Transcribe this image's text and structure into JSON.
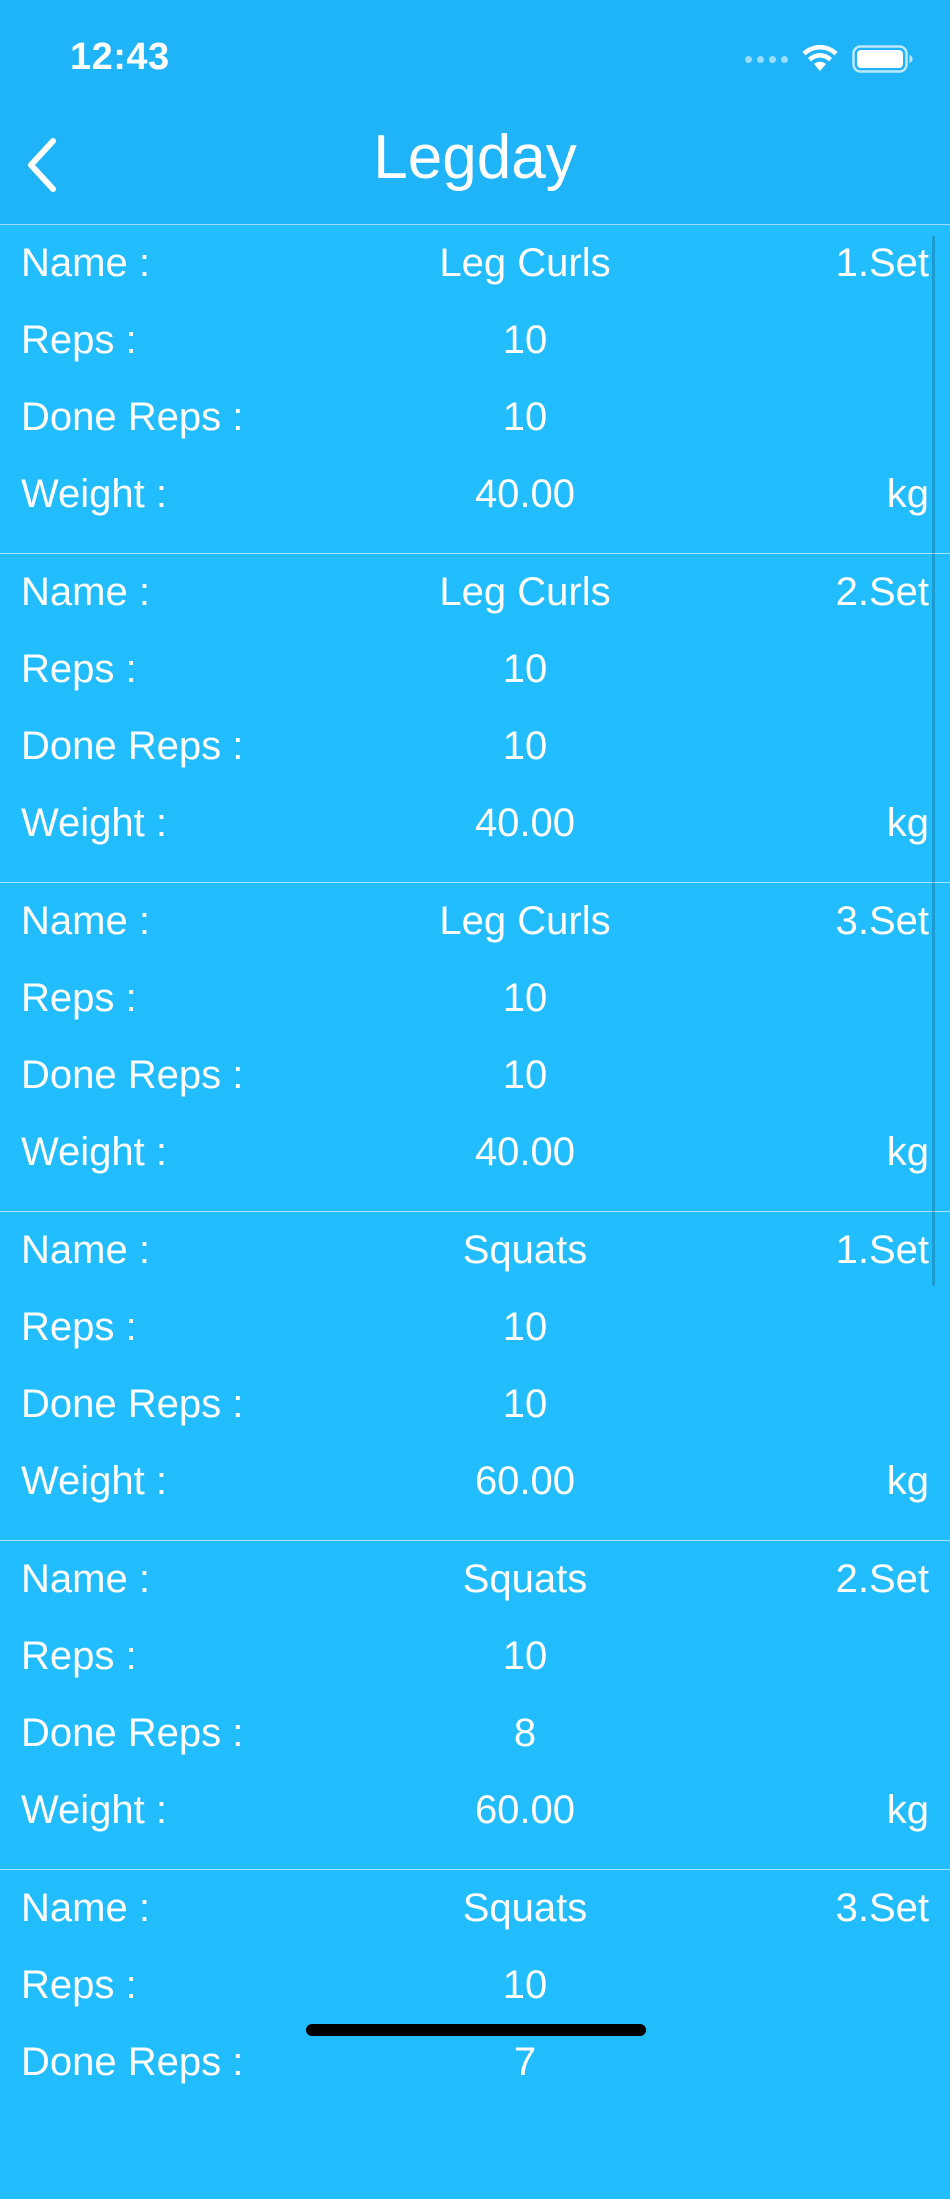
{
  "status_bar": {
    "time": "12:43"
  },
  "nav": {
    "title": "Legday"
  },
  "labels": {
    "name": "Name :",
    "reps": "Reps :",
    "done_reps": "Done Reps :",
    "weight": "Weight :",
    "unit": "kg"
  },
  "sets": [
    {
      "name": "Leg Curls",
      "set": "1.Set",
      "reps": "10",
      "done_reps": "10",
      "weight": "40.00"
    },
    {
      "name": "Leg Curls",
      "set": "2.Set",
      "reps": "10",
      "done_reps": "10",
      "weight": "40.00"
    },
    {
      "name": "Leg Curls",
      "set": "3.Set",
      "reps": "10",
      "done_reps": "10",
      "weight": "40.00"
    },
    {
      "name": "Squats",
      "set": "1.Set",
      "reps": "10",
      "done_reps": "10",
      "weight": "60.00"
    },
    {
      "name": "Squats",
      "set": "2.Set",
      "reps": "10",
      "done_reps": "8",
      "weight": "60.00"
    },
    {
      "name": "Squats",
      "set": "3.Set",
      "reps": "10",
      "done_reps": "7",
      "weight": ""
    }
  ],
  "colors": {
    "background": "#22bdfe",
    "header": "#1fb3f8",
    "text": "#ffffff"
  }
}
